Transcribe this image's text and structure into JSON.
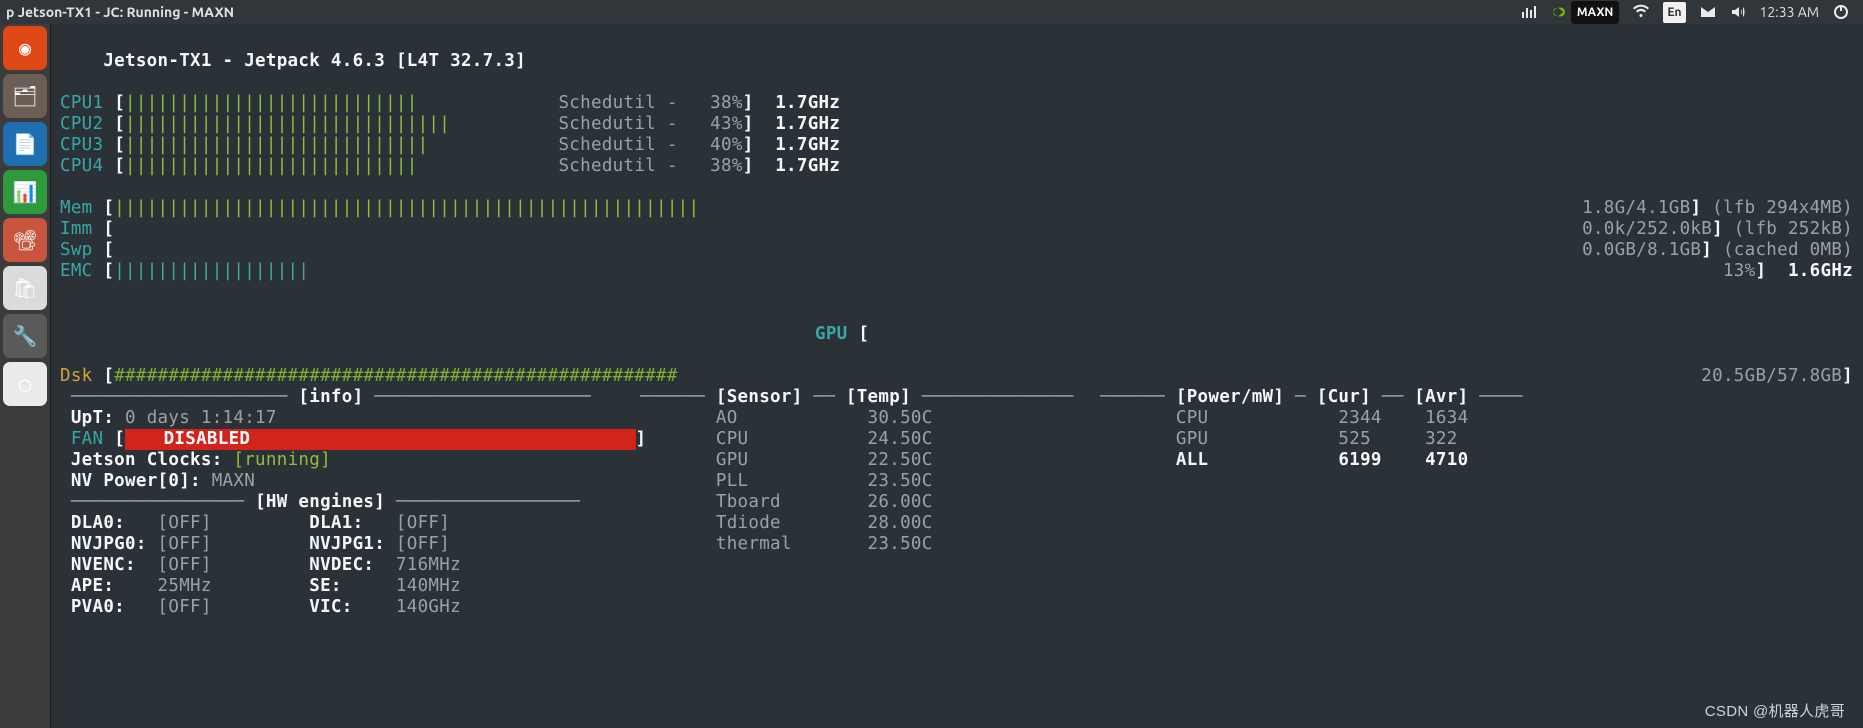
{
  "panel": {
    "title": "p Jetson-TX1 - JC: Running - MAXN",
    "nvidia_mode": "MAXN",
    "lang": "En",
    "time": "12:33 AM"
  },
  "header": {
    "host": "Jetson-TX1",
    "jetpack": "Jetpack 4.6.3",
    "l4t": "[L4T 32.7.3]"
  },
  "cpus": [
    {
      "name": "CPU1",
      "gov": "Schedutil",
      "pct": "38%",
      "freq": "1.7GHz",
      "ticks": 27
    },
    {
      "name": "CPU2",
      "gov": "Schedutil",
      "pct": "43%",
      "freq": "1.7GHz",
      "ticks": 30
    },
    {
      "name": "CPU3",
      "gov": "Schedutil",
      "pct": "40%",
      "freq": "1.7GHz",
      "ticks": 28
    },
    {
      "name": "CPU4",
      "gov": "Schedutil",
      "pct": "38%",
      "freq": "1.7GHz",
      "ticks": 27
    }
  ],
  "mem": {
    "label": "Mem",
    "used": "1.8G",
    "total": "4.1GB",
    "lfb": "(lfb 294x4MB)",
    "ticks": 54
  },
  "imm": {
    "label": "Imm",
    "used": "0.0k",
    "total": "252.0kB",
    "lfb": "(lfb 252kB)"
  },
  "swp": {
    "label": "Swp",
    "used": "0.0GB",
    "total": "8.1GB",
    "lfb": "(cached 0MB)"
  },
  "emc": {
    "label": "EMC",
    "pct": "13%",
    "freq": "1.6GHz",
    "ticks": 18
  },
  "gpu": {
    "label": "GPU"
  },
  "dsk": {
    "label": "Dsk",
    "used": "20.5GB",
    "total": "57.8GB",
    "hashes": 52
  },
  "info": {
    "title": "[info]",
    "uptime_label": "UpT:",
    "uptime": "0 days 1:14:17",
    "fan_label": "FAN",
    "fan_status": "DISABLED",
    "jc_label": "Jetson Clocks:",
    "jc_status": "[running]",
    "nvp_label": "NV Power[0]:",
    "nvp_val": "MAXN"
  },
  "hw": {
    "title": "[HW engines]",
    "rows": [
      {
        "l": "DLA0:",
        "lv": "[OFF]",
        "r": "DLA1:",
        "rv": "[OFF]"
      },
      {
        "l": "NVJPG0:",
        "lv": "[OFF]",
        "r": "NVJPG1:",
        "rv": "[OFF]"
      },
      {
        "l": "NVENC:",
        "lv": "[OFF]",
        "r": "NVDEC:",
        "rv": "716MHz"
      },
      {
        "l": "APE:",
        "lv": "25MHz",
        "r": "SE:",
        "rv": "140MHz"
      },
      {
        "l": "PVA0:",
        "lv": "[OFF]",
        "r": "VIC:",
        "rv": "140GHz"
      }
    ]
  },
  "sensors": {
    "title_sensor": "[Sensor]",
    "title_temp": "[Temp]",
    "rows": [
      {
        "n": "AO",
        "t": "30.50C"
      },
      {
        "n": "CPU",
        "t": "24.50C"
      },
      {
        "n": "GPU",
        "t": "22.50C"
      },
      {
        "n": "PLL",
        "t": "23.50C"
      },
      {
        "n": "Tboard",
        "t": "26.00C"
      },
      {
        "n": "Tdiode",
        "t": "28.00C"
      },
      {
        "n": "thermal",
        "t": "23.50C"
      }
    ]
  },
  "power": {
    "title_pw": "[Power/mW]",
    "title_cur": "[Cur]",
    "title_avr": "[Avr]",
    "rows": [
      {
        "n": "CPU",
        "c": "2344",
        "a": "1634"
      },
      {
        "n": "GPU",
        "c": "525",
        "a": "322"
      },
      {
        "n": "ALL",
        "c": "6199",
        "a": "4710",
        "bold": true
      }
    ]
  },
  "launcher": [
    {
      "name": "ubuntu",
      "bg": "#dd4814",
      "glyph": "◉"
    },
    {
      "name": "files",
      "bg": "#6b5e55",
      "glyph": "🗂"
    },
    {
      "name": "writer",
      "bg": "#1f6fb0",
      "glyph": "📄"
    },
    {
      "name": "calc",
      "bg": "#2d9a3e",
      "glyph": "📊"
    },
    {
      "name": "impress",
      "bg": "#c8553d",
      "glyph": "📽"
    },
    {
      "name": "software",
      "bg": "#d9dbdc",
      "glyph": "🛍"
    },
    {
      "name": "settings",
      "bg": "#5a5a5a",
      "glyph": "🔧"
    },
    {
      "name": "chromium",
      "bg": "#e9eaec",
      "glyph": "◯"
    }
  ],
  "watermark": "CSDN @机器人虎哥"
}
